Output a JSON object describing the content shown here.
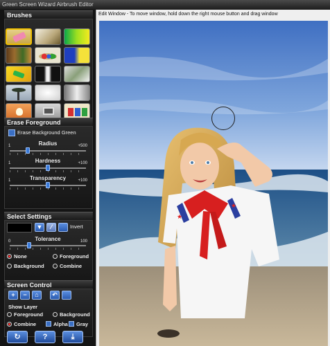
{
  "app": {
    "title": "Green Screen Wizard Airbrush Editor"
  },
  "brushes": {
    "title": "Brushes",
    "thumbnails": [
      "eraser-brush",
      "photo-brush-flowers",
      "green-yellow-gradient-brush",
      "forest-photo-brush",
      "color-palette-brush",
      "blue-yellow-gradient-brush",
      "yellow-gradient-brush",
      "tuxedo-photo-brush",
      "bridal-photo-brush",
      "palm-tree-photo-brush",
      "white-texture-brush",
      "silver-gradient-brush",
      "lamp-brush",
      "computer-brush",
      "paint-buckets-brush"
    ]
  },
  "erase": {
    "title": "Erase Foreground",
    "checkbox_label": "Erase Background Green",
    "radius": {
      "label": "Radius",
      "min": "1",
      "max": "+500",
      "value": 0.24
    },
    "hardness": {
      "label": "Hardness",
      "min": "1",
      "max": "+100",
      "value": 0.5
    },
    "transparency": {
      "label": "Transparency",
      "min": "1",
      "max": "+100",
      "value": 0.5
    }
  },
  "select": {
    "title": "Select Settings",
    "invert_label": "Invert",
    "tolerance": {
      "label": "Tolerance",
      "min": "0",
      "max": "100",
      "value": 0.25
    },
    "options": [
      "None",
      "Foreground",
      "Background",
      "Combine"
    ]
  },
  "screen": {
    "title": "Screen Control",
    "show_layer_label": "Show Layer",
    "layers": [
      "Foreground",
      "Background",
      "Combine",
      "Alpha",
      "Gray"
    ]
  },
  "bottom_buttons": [
    "?"
  ],
  "edit_window": {
    "title": "Edit Window - To move window, hold down the right mouse button and drag window"
  },
  "colors": {
    "accent": "#2f6fd0",
    "selected_brush_border": "#f0c000",
    "panel_bg": "#141414"
  }
}
